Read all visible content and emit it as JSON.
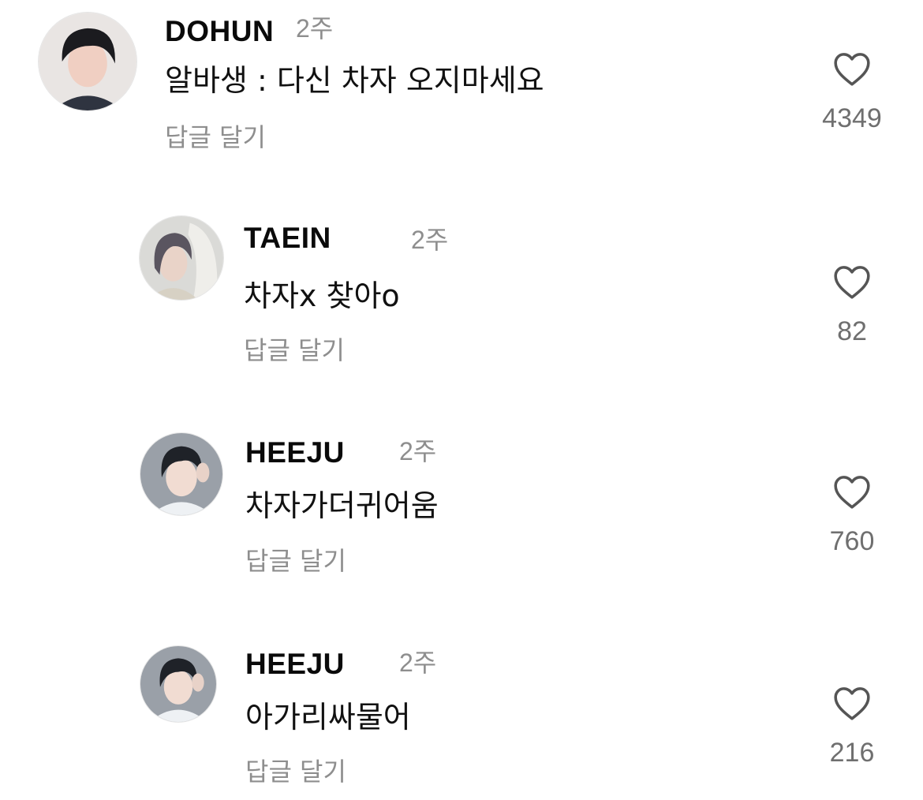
{
  "comments": [
    {
      "username": "DOHUN",
      "time": "2주",
      "text": "알바생 : 다신 차자 오지마세요",
      "reply_label": "답글 달기",
      "likes": "4349",
      "avatar_colors": {
        "bg": "#e9e5e3",
        "hair": "#1b1b1f",
        "skin": "#f0cfc2",
        "shirt": "#2f3440"
      }
    },
    {
      "username": "TAEIN",
      "time": "2주",
      "text": "차자x 찾아o",
      "reply_label": "답글 달기",
      "likes": "82",
      "avatar_colors": {
        "bg": "#dadad7",
        "hair": "#5a5560",
        "skin": "#e9d3c8",
        "shirt": "#d7d1c4"
      }
    },
    {
      "username": "HEEJU",
      "time": "2주",
      "text": "차자가더귀어움",
      "reply_label": "답글 달기",
      "likes": "760",
      "avatar_colors": {
        "bg": "#9aa0a8",
        "hair": "#1f2228",
        "skin": "#f1dcd2",
        "shirt": "#eef1f4"
      }
    },
    {
      "username": "HEEJU",
      "time": "2주",
      "text": "아가리싸물어",
      "reply_label": "답글 달기",
      "likes": "216",
      "avatar_colors": {
        "bg": "#9aa0a8",
        "hair": "#1f2228",
        "skin": "#f1dcd2",
        "shirt": "#eef1f4"
      }
    }
  ],
  "icons": {
    "like": "heart-outline-icon"
  },
  "colors": {
    "username": "#0a0a0a",
    "muted": "#8e8e8e",
    "like_count": "#6f6f6f"
  }
}
